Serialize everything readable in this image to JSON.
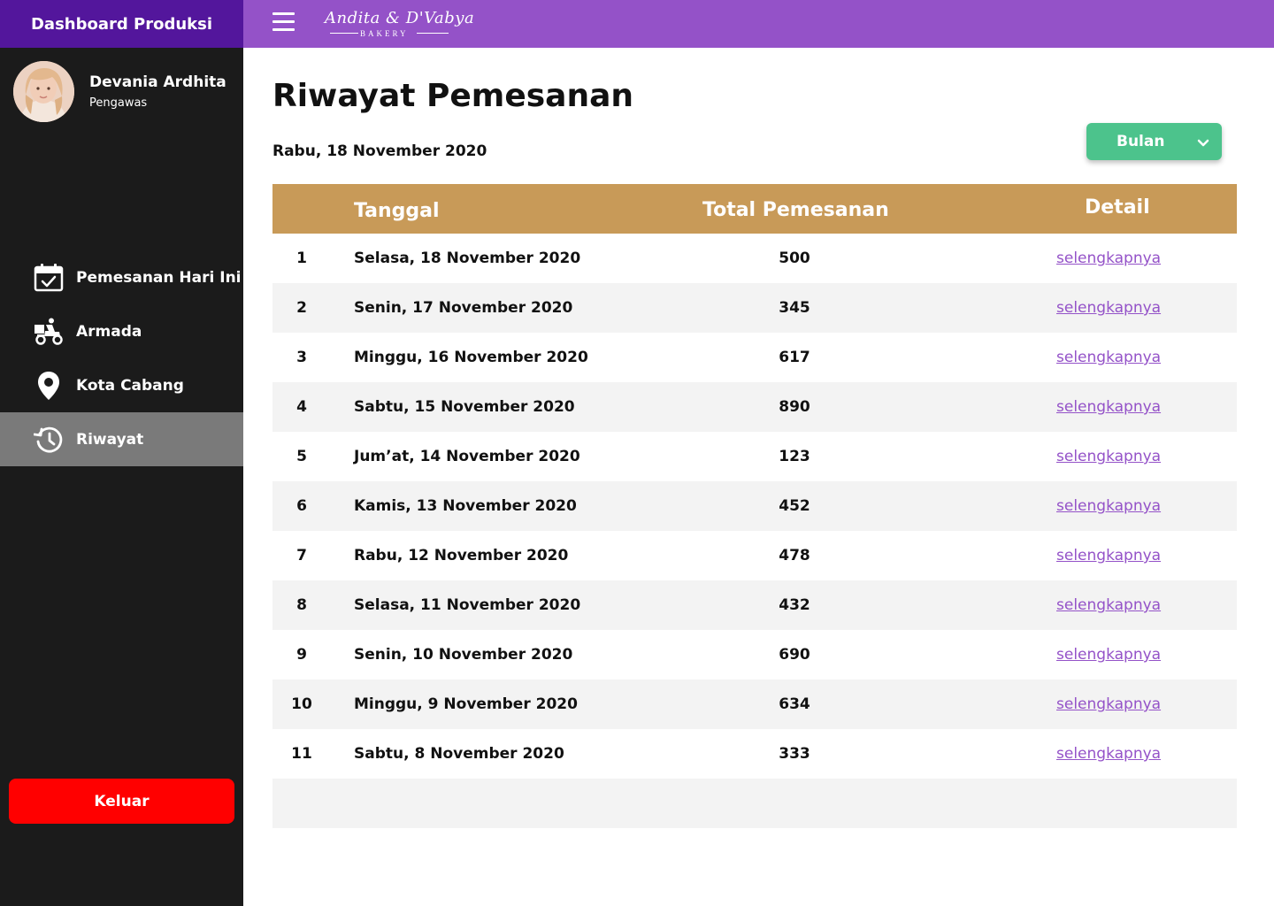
{
  "sidebar": {
    "header": "Dashboard Produksi",
    "profile": {
      "name": "Devania Ardhita",
      "role": "Pengawas"
    },
    "nav": [
      {
        "label": "Pemesanan Hari Ini",
        "icon": "calendar-check-icon"
      },
      {
        "label": "Armada",
        "icon": "delivery-scooter-icon"
      },
      {
        "label": "Kota Cabang",
        "icon": "location-pin-icon"
      },
      {
        "label": "Riwayat",
        "icon": "history-icon",
        "active": true
      }
    ],
    "logout": "Keluar"
  },
  "topbar": {
    "brand": "Andita & D'Vabya",
    "brand_sub": "BAKERY"
  },
  "main": {
    "title": "Riwayat Pemesanan",
    "date": "Rabu, 18 November 2020",
    "filter": "Bulan",
    "table": {
      "headers": {
        "date": "Tanggal",
        "total": "Total Pemesanan",
        "detail": "Detail"
      },
      "rows": [
        {
          "no": "1",
          "date": "Selasa, 18 November 2020",
          "total": "500",
          "link": "selengkapnya"
        },
        {
          "no": "2",
          "date": "Senin, 17 November 2020",
          "total": "345",
          "link": "selengkapnya"
        },
        {
          "no": "3",
          "date": "Minggu, 16 November 2020",
          "total": "617",
          "link": "selengkapnya"
        },
        {
          "no": "4",
          "date": "Sabtu, 15 November 2020",
          "total": "890",
          "link": "selengkapnya"
        },
        {
          "no": "5",
          "date": "Jum’at, 14 November 2020",
          "total": "123",
          "link": "selengkapnya"
        },
        {
          "no": "6",
          "date": "Kamis, 13 November 2020",
          "total": "452",
          "link": "selengkapnya"
        },
        {
          "no": "7",
          "date": "Rabu, 12 November 2020",
          "total": "478",
          "link": "selengkapnya"
        },
        {
          "no": "8",
          "date": "Selasa, 11 November 2020",
          "total": "432",
          "link": "selengkapnya"
        },
        {
          "no": "9",
          "date": "Senin, 10 November 2020",
          "total": "690",
          "link": "selengkapnya"
        },
        {
          "no": "10",
          "date": "Minggu, 9 November 2020",
          "total": "634",
          "link": "selengkapnya"
        },
        {
          "no": "11",
          "date": "Sabtu, 8 November 2020",
          "total": "333",
          "link": "selengkapnya"
        }
      ]
    }
  },
  "colors": {
    "sidebar_header": "#53169c",
    "topbar": "#9452c8",
    "sidebar_bg": "#1b1b1b",
    "active_nav": "#7a7a7a",
    "table_header": "#c89a58",
    "filter_button": "#4cc38c",
    "logout_button": "#ff0000",
    "link": "#9452c8"
  }
}
